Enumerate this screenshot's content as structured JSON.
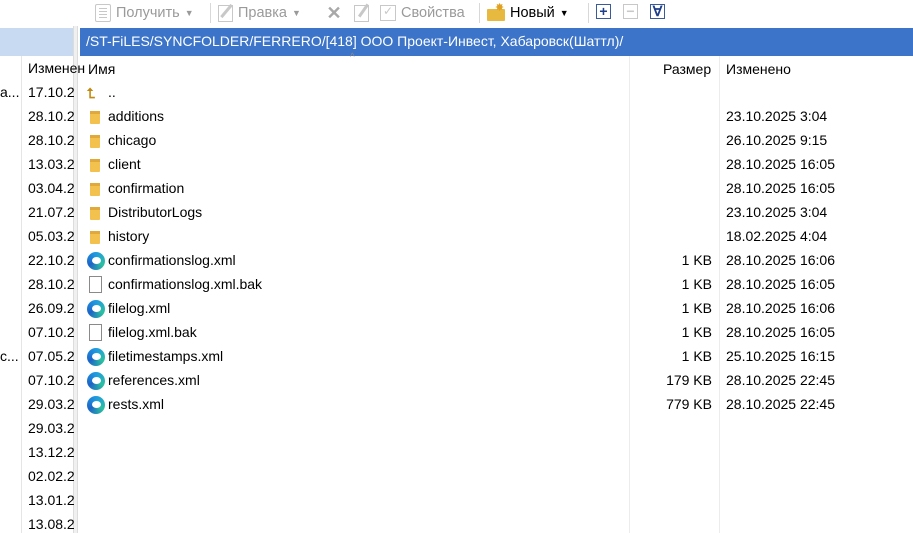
{
  "toolbar": {
    "get_label": "Получить",
    "edit_label": "Правка",
    "properties_label": "Свойства",
    "new_label": "Новый",
    "plus_symbol": "+",
    "minus_symbol": "−",
    "filter_symbol": "∀"
  },
  "right_panel": {
    "path": "/ST-FiLES/SYNCFOLDER/FERRERO/[418] ООО Проект-Инвест, Хабаровск(Шаттл)/",
    "columns": {
      "name": "Имя",
      "size": "Размер",
      "modified": "Изменено"
    },
    "rows": [
      {
        "type": "up",
        "name": "..",
        "size": "",
        "modified": ""
      },
      {
        "type": "folder",
        "name": "additions",
        "size": "",
        "modified": "23.10.2025 3:04"
      },
      {
        "type": "folder",
        "name": "chicago",
        "size": "",
        "modified": "26.10.2025 9:15"
      },
      {
        "type": "folder",
        "name": "client",
        "size": "",
        "modified": "28.10.2025 16:05"
      },
      {
        "type": "folder",
        "name": "confirmation",
        "size": "",
        "modified": "28.10.2025 16:05"
      },
      {
        "type": "folder",
        "name": "DistributorLogs",
        "size": "",
        "modified": "23.10.2025 3:04"
      },
      {
        "type": "folder",
        "name": "history",
        "size": "",
        "modified": "18.02.2025 4:04"
      },
      {
        "type": "edge",
        "name": "confirmationslog.xml",
        "size": "1 KB",
        "modified": "28.10.2025 16:06"
      },
      {
        "type": "file",
        "name": "confirmationslog.xml.bak",
        "size": "1 KB",
        "modified": "28.10.2025 16:05"
      },
      {
        "type": "edge",
        "name": "filelog.xml",
        "size": "1 KB",
        "modified": "28.10.2025 16:06"
      },
      {
        "type": "file",
        "name": "filelog.xml.bak",
        "size": "1 KB",
        "modified": "28.10.2025 16:05"
      },
      {
        "type": "edge",
        "name": "filetimestamps.xml",
        "size": "1 KB",
        "modified": "25.10.2025 16:15"
      },
      {
        "type": "edge",
        "name": "references.xml",
        "size": "179 KB",
        "modified": "28.10.2025 22:45"
      },
      {
        "type": "edge",
        "name": "rests.xml",
        "size": "779 KB",
        "modified": "28.10.2025 22:45"
      }
    ]
  },
  "left_panel": {
    "column": "Изменен",
    "rows": [
      "17.10.2",
      "28.10.2",
      "28.10.2",
      "13.03.2",
      "03.04.2",
      "21.07.2",
      "05.03.2",
      "22.10.2",
      "28.10.2",
      "26.09.2",
      "07.10.2",
      "07.05.2",
      "07.10.2",
      "29.03.2",
      "29.03.2",
      "13.12.2",
      "02.02.2",
      "13.01.2",
      "13.08.2"
    ],
    "fragments": [
      {
        "row": 0,
        "text": "a..."
      },
      {
        "row": 11,
        "text": "c..."
      }
    ]
  }
}
